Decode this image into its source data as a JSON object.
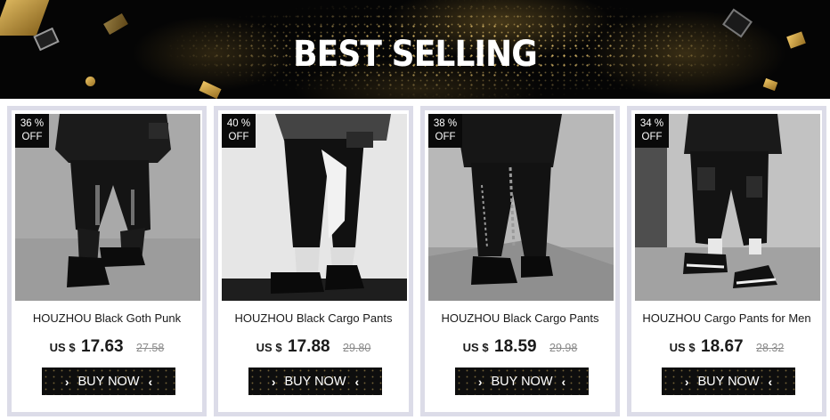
{
  "banner": {
    "title": "BEST SELLING"
  },
  "products": [
    {
      "discount_value": "36",
      "discount_unit": "%",
      "discount_label": "OFF",
      "title": "HOUZHOU Black Goth Punk",
      "currency": "US $",
      "price": "17.63",
      "old_price": "27.58",
      "button": "BUY NOW"
    },
    {
      "discount_value": "40",
      "discount_unit": "%",
      "discount_label": "OFF",
      "title": "HOUZHOU Black Cargo Pants",
      "currency": "US $",
      "price": "17.88",
      "old_price": "29.80",
      "button": "BUY NOW"
    },
    {
      "discount_value": "38",
      "discount_unit": "%",
      "discount_label": "OFF",
      "title": "HOUZHOU Black Cargo Pants",
      "currency": "US $",
      "price": "18.59",
      "old_price": "29.98",
      "button": "BUY NOW"
    },
    {
      "discount_value": "34",
      "discount_unit": "%",
      "discount_label": "OFF",
      "title": "HOUZHOU Cargo Pants for Men",
      "currency": "US $",
      "price": "18.67",
      "old_price": "28.32",
      "button": "BUY NOW"
    }
  ],
  "icons": {
    "button_left": "chevron-right-icon",
    "button_right": "chevron-left-icon"
  },
  "colors": {
    "banner_bg": "#050505",
    "gold": "#d8b060",
    "card_border": "#dcdce8",
    "button_bg": "#0e0e0e"
  }
}
